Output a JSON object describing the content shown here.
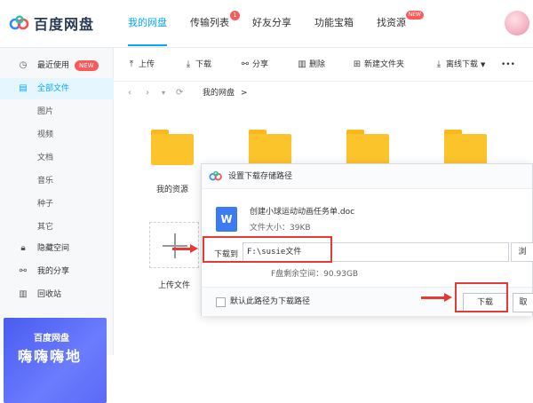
{
  "app": {
    "logo_text": "百度网盘"
  },
  "nav": [
    {
      "label": "我的网盘",
      "active": true
    },
    {
      "label": "传输列表",
      "badge": "1"
    },
    {
      "label": "好友分享"
    },
    {
      "label": "功能宝箱"
    },
    {
      "label": "找资源",
      "badge_new": "NEW"
    }
  ],
  "sidebar": {
    "items": [
      {
        "label": "最近使用",
        "icon": "clock-icon",
        "badge": "NEW"
      },
      {
        "label": "全部文件",
        "icon": "document-icon",
        "active": true
      },
      {
        "label": "图片"
      },
      {
        "label": "视频"
      },
      {
        "label": "文档"
      },
      {
        "label": "音乐"
      },
      {
        "label": "种子"
      },
      {
        "label": "其它"
      },
      {
        "label": "隐藏空间",
        "icon": "lock-icon"
      },
      {
        "label": "我的分享",
        "icon": "share-icon"
      },
      {
        "label": "回收站",
        "icon": "trash-icon"
      }
    ],
    "promo": {
      "logo": "百度网盘",
      "headline": "嗨嗨嗨地"
    }
  },
  "toolbar": {
    "upload": "上传",
    "download": "下载",
    "share": "分享",
    "delete": "删除",
    "new_folder": "新建文件夹",
    "offline_download": "离线下载",
    "more": "•••"
  },
  "breadcrumb": {
    "root": "我的网盘",
    "separator": ">"
  },
  "files": [
    {
      "name": "我的资源",
      "type": "folder"
    }
  ],
  "upload_tile": {
    "label": "上传文件"
  },
  "dialog": {
    "title": "设置下载存储路径",
    "file_icon_letter": "W",
    "file_name": "创建小球运动动画任务单.doc",
    "file_size": "文件大小：39KB",
    "download_to_label": "下载到",
    "path": "F:\\susie文件",
    "browse": "浏",
    "free_space": "F盘剩余空间：90.93GB",
    "default_checkbox_label": "默认此路径为下载路径",
    "download_button": "下载",
    "cancel_button": "取"
  },
  "colors": {
    "accent": "#06a7ff",
    "annotation_red": "#e53935",
    "folder_yellow": "#fcc42b",
    "badge_red": "#fa5a5a"
  }
}
